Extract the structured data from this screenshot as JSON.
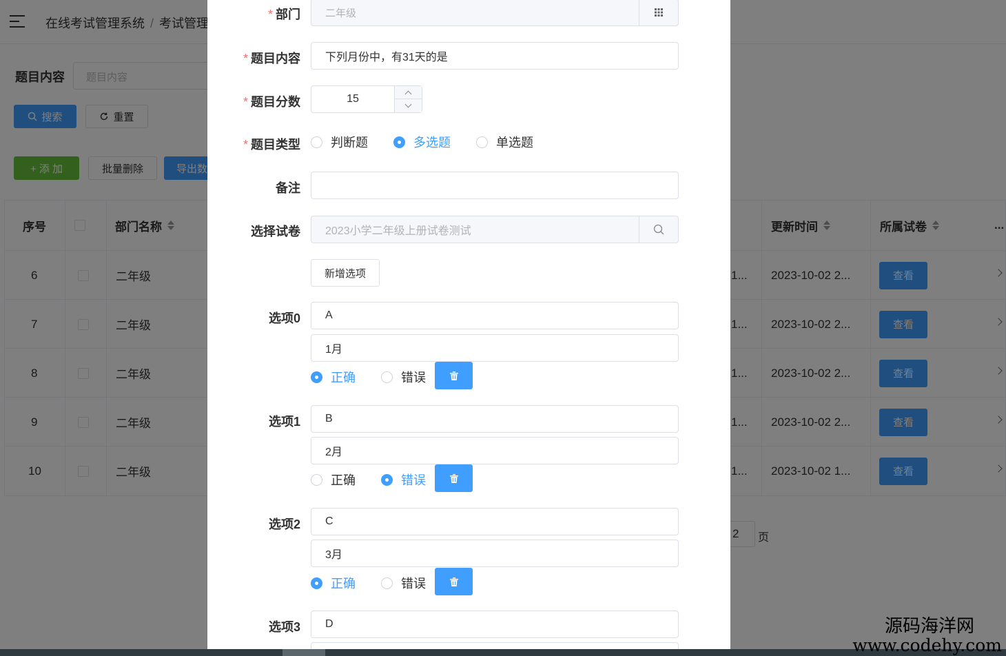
{
  "page": {
    "breadcrumb": [
      "在线考试管理系统",
      "考试管理"
    ],
    "search": {
      "label": "题目内容",
      "placeholder": "题目内容",
      "search_btn": "搜索",
      "reset_btn": "重置"
    },
    "toolbar": {
      "add_btn": "+ 添 加",
      "batch_delete_btn": "批量删除",
      "export_btn": "导出数"
    },
    "table": {
      "columns": [
        "序号",
        "部门名称",
        "更新时间",
        "所属试卷",
        "..."
      ],
      "rows": [
        {
          "index": "6",
          "dept": "二年级",
          "trunc": "1...",
          "updated": "2023-10-02 2...",
          "action": "查看"
        },
        {
          "index": "7",
          "dept": "二年级",
          "trunc": "1...",
          "updated": "2023-10-02 2...",
          "action": "查看"
        },
        {
          "index": "8",
          "dept": "二年级",
          "trunc": "1...",
          "updated": "2023-10-02 2...",
          "action": "查看"
        },
        {
          "index": "9",
          "dept": "二年级",
          "trunc": "1...",
          "updated": "2023-10-02 2...",
          "action": "查看"
        },
        {
          "index": "10",
          "dept": "二年级",
          "trunc": "1...",
          "updated": "2023-10-02 1...",
          "action": "查看"
        }
      ]
    },
    "pager": {
      "page_value": "2",
      "page_suffix": "页"
    }
  },
  "dialog": {
    "dept": {
      "label": "部门",
      "value": "二年级"
    },
    "content": {
      "label": "题目内容",
      "value": "下列月份中，有31天的是"
    },
    "score": {
      "label": "题目分数",
      "value": "15"
    },
    "type": {
      "label": "题目类型",
      "options": [
        "判断题",
        "多选题",
        "单选题"
      ],
      "selected": "多选题"
    },
    "remark": {
      "label": "备注",
      "value": ""
    },
    "paper": {
      "label": "选择试卷",
      "value": "2023小学二年级上册试卷测试"
    },
    "add_option_btn": "新增选项",
    "option_labels": {
      "correct": "正确",
      "wrong": "错误"
    },
    "options": [
      {
        "label": "选项0",
        "key": "A",
        "text": "1月",
        "correct": true
      },
      {
        "label": "选项1",
        "key": "B",
        "text": "2月",
        "correct": false
      },
      {
        "label": "选项2",
        "key": "C",
        "text": "3月",
        "correct": true
      },
      {
        "label": "选项3",
        "key": "D",
        "text": "",
        "correct": null
      }
    ]
  },
  "watermark": {
    "cn": "源码海洋网",
    "url": "www.codehy.com"
  },
  "colors": {
    "primary": "#409eff",
    "success": "#67c23a",
    "required": "#f56c6c",
    "overlay": "rgba(0,0,0,0.5)"
  }
}
